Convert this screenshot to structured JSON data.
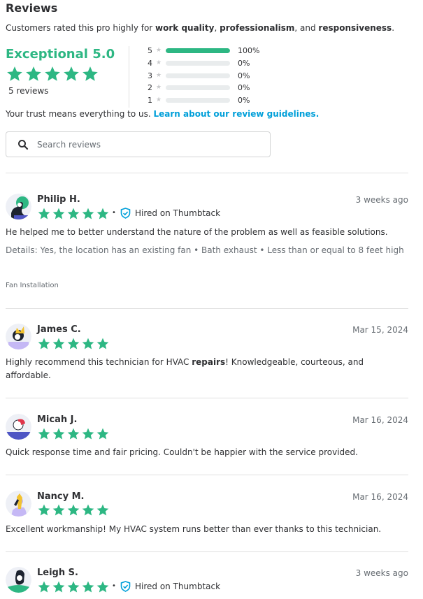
{
  "header": {
    "title": "Reviews",
    "subtitle_prefix": "Customers rated this pro highly for ",
    "quality_1": "work quality",
    "sep_1": ", ",
    "quality_2": "professionalism",
    "sep_2": ", and ",
    "quality_3": "responsiveness",
    "subtitle_suffix": "."
  },
  "summary": {
    "label": "Exceptional 5.0",
    "rating": 5.0,
    "review_count": "5 reviews"
  },
  "distribution": [
    {
      "stars": "5",
      "fraction": 1.0,
      "percent": "100%"
    },
    {
      "stars": "4",
      "fraction": 0.0,
      "percent": "0%"
    },
    {
      "stars": "3",
      "fraction": 0.0,
      "percent": "0%"
    },
    {
      "stars": "2",
      "fraction": 0.0,
      "percent": "0%"
    },
    {
      "stars": "1",
      "fraction": 0.0,
      "percent": "0%"
    }
  ],
  "trust": {
    "text": "Your trust means everything to us. ",
    "link": "Learn about our review guidelines."
  },
  "search": {
    "placeholder": "Search reviews"
  },
  "colors": {
    "star_green": "#2db783",
    "link_blue": "#009fd9",
    "hired_blue": "#009fd9"
  },
  "reviews": [
    {
      "name": "Philip H.",
      "date": "3 weeks ago",
      "rating": 5,
      "hired_label": "Hired on Thumbtack",
      "text": "He helped me to better understand the nature of the problem as well as feasible solutions.",
      "details": "Details: Yes, the location has an existing fan • Bath exhaust • Less than or equal to 8 feet high",
      "category": "Fan Installation"
    },
    {
      "name": "James C.",
      "date": "Mar 15, 2024",
      "rating": 5,
      "text_before": "Highly recommend this technician for HVAC ",
      "text_bold": "repairs",
      "text_after": "! Knowledgeable, courteous, and affordable."
    },
    {
      "name": "Micah J.",
      "date": "Mar 16, 2024",
      "rating": 5,
      "text": "Quick response time and fair pricing. Couldn't be happier with the service provided."
    },
    {
      "name": "Nancy M.",
      "date": "Mar 16, 2024",
      "rating": 5,
      "text": "Excellent workmanship! My HVAC system runs better than ever thanks to this technician."
    },
    {
      "name": "Leigh S.",
      "date": "3 weeks ago",
      "rating": 5,
      "hired_label": "Hired on Thumbtack"
    }
  ]
}
